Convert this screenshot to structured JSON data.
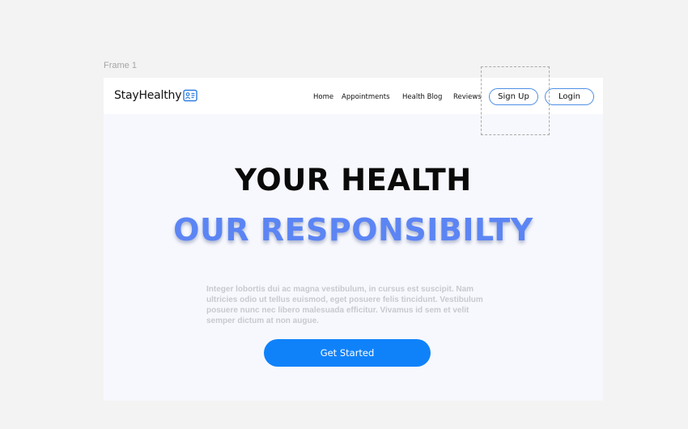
{
  "canvas": {
    "frame_label": "Frame 1"
  },
  "navbar": {
    "brand": "StayHealthy",
    "brand_icon": "id-card-icon",
    "links": [
      "Home",
      "Appointments",
      "Health Blog",
      "Reviews"
    ],
    "signup_label": "Sign Up",
    "login_label": "Login"
  },
  "hero": {
    "headline_line1": "YOUR HEALTH",
    "headline_line2": "OUR RESPONSIBILTY",
    "body": "Integer lobortis dui ac magna vestibulum, in cursus est suscipit. Nam ultricies odio ut tellus euismod, eget posuere felis tincidunt. Vestibulum posuere nunc nec libero malesuada efficitur. Vivamus id sem et velit semper dictum at non augue.",
    "cta_label": "Get Started"
  },
  "colors": {
    "accent": "#0f82fa",
    "headline_accent": "#5c85f4",
    "pill_border": "#4f8fe6",
    "frame_bg": "#f7f8fd",
    "canvas_bg": "#f3f3f3"
  }
}
